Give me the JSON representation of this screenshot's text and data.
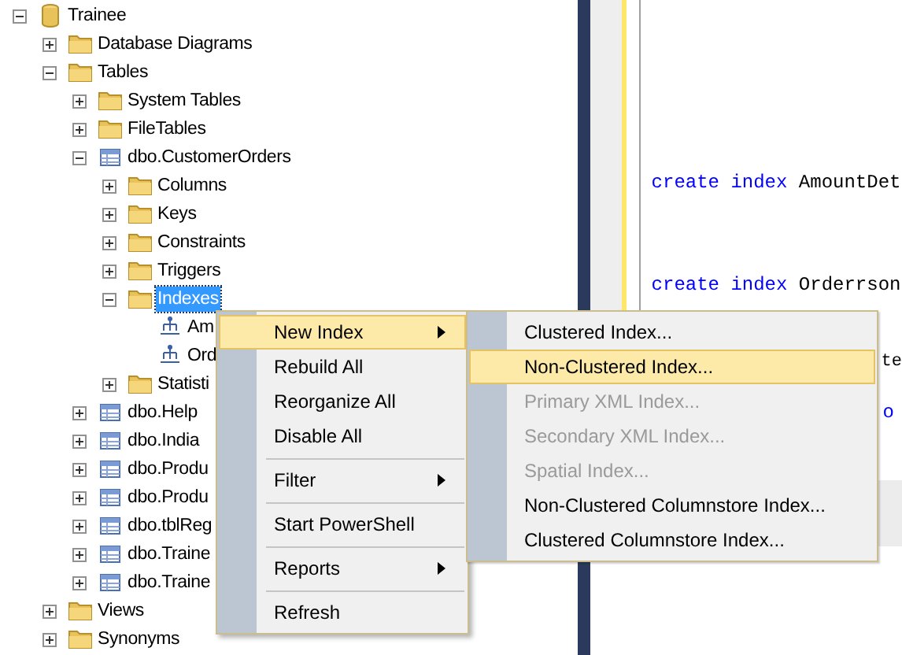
{
  "object_explorer": {
    "tree": [
      {
        "label": "Trainee",
        "kind": "database",
        "expanded": true,
        "selected": false,
        "children": [
          {
            "label": "Database Diagrams",
            "kind": "folder",
            "expanded": false,
            "selected": false
          },
          {
            "label": "Tables",
            "kind": "folder",
            "expanded": true,
            "selected": false,
            "children": [
              {
                "label": "System Tables",
                "kind": "folder",
                "expanded": false,
                "selected": false
              },
              {
                "label": "FileTables",
                "kind": "folder",
                "expanded": false,
                "selected": false
              },
              {
                "label": "dbo.CustomerOrders",
                "kind": "table",
                "expanded": true,
                "selected": false,
                "children": [
                  {
                    "label": "Columns",
                    "kind": "folder",
                    "expanded": false,
                    "selected": false
                  },
                  {
                    "label": "Keys",
                    "kind": "folder",
                    "expanded": false,
                    "selected": false
                  },
                  {
                    "label": "Constraints",
                    "kind": "folder",
                    "expanded": false,
                    "selected": false
                  },
                  {
                    "label": "Triggers",
                    "kind": "folder",
                    "expanded": false,
                    "selected": false
                  },
                  {
                    "label": "Indexes",
                    "kind": "folder",
                    "expanded": true,
                    "selected": true,
                    "children": [
                      {
                        "label": "Am",
                        "kind": "index",
                        "selected": false
                      },
                      {
                        "label": "Ord",
                        "kind": "index",
                        "selected": false
                      }
                    ]
                  },
                  {
                    "label": "Statisti",
                    "kind": "folder",
                    "expanded": false,
                    "selected": false
                  }
                ]
              },
              {
                "label": "dbo.Help",
                "kind": "table",
                "expanded": false,
                "selected": false
              },
              {
                "label": "dbo.India",
                "kind": "table",
                "expanded": false,
                "selected": false
              },
              {
                "label": "dbo.Produ",
                "kind": "table",
                "expanded": false,
                "selected": false
              },
              {
                "label": "dbo.Produ",
                "kind": "table",
                "expanded": false,
                "selected": false
              },
              {
                "label": "dbo.tblReg",
                "kind": "table",
                "expanded": false,
                "selected": false
              },
              {
                "label": "dbo.Traine",
                "kind": "table",
                "expanded": false,
                "selected": false
              },
              {
                "label": "dbo.Traine",
                "kind": "table",
                "expanded": false,
                "selected": false
              }
            ]
          },
          {
            "label": "Views",
            "kind": "folder",
            "expanded": false,
            "selected": false
          },
          {
            "label": "Synonyms",
            "kind": "folder",
            "expanded": false,
            "selected": false
          }
        ]
      }
    ]
  },
  "editor": {
    "lines": [
      {
        "kind": "statement",
        "keyword": "create index",
        "text": "AmountDet"
      },
      {
        "kind": "statement",
        "keyword": "create index",
        "text": "Orderrson"
      },
      {
        "kind": "tail",
        "text": "te"
      },
      {
        "kind": "tail_keyword",
        "text": "o"
      }
    ]
  },
  "context_menu": {
    "items": [
      {
        "kind": "item",
        "label": "New Index",
        "submenu": true,
        "selected": true
      },
      {
        "kind": "item",
        "label": "Rebuild All",
        "submenu": false,
        "selected": false
      },
      {
        "kind": "item",
        "label": "Reorganize All",
        "submenu": false,
        "selected": false
      },
      {
        "kind": "item",
        "label": "Disable All",
        "submenu": false,
        "selected": false
      },
      {
        "kind": "separator"
      },
      {
        "kind": "item",
        "label": "Filter",
        "submenu": true,
        "selected": false
      },
      {
        "kind": "separator"
      },
      {
        "kind": "item",
        "label": "Start PowerShell",
        "submenu": false,
        "selected": false
      },
      {
        "kind": "separator"
      },
      {
        "kind": "item",
        "label": "Reports",
        "submenu": true,
        "selected": false
      },
      {
        "kind": "separator"
      },
      {
        "kind": "item",
        "label": "Refresh",
        "submenu": false,
        "selected": false
      }
    ]
  },
  "submenu": {
    "items": [
      {
        "label": "Clustered Index...",
        "selected": false,
        "disabled": false
      },
      {
        "label": "Non-Clustered Index...",
        "selected": true,
        "disabled": false
      },
      {
        "label": "Primary XML Index...",
        "selected": false,
        "disabled": true
      },
      {
        "label": "Secondary XML Index...",
        "selected": false,
        "disabled": true
      },
      {
        "label": "Spatial Index...",
        "selected": false,
        "disabled": true
      },
      {
        "label": "Non-Clustered Columnstore Index...",
        "selected": false,
        "disabled": false
      },
      {
        "label": "Clustered Columnstore Index...",
        "selected": false,
        "disabled": false
      }
    ]
  }
}
